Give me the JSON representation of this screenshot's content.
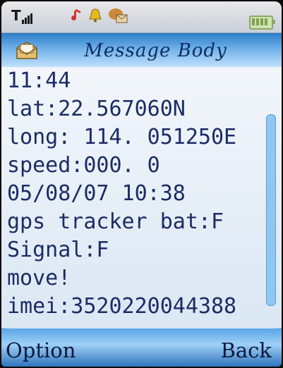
{
  "status_bar": {
    "signal_label": "T",
    "icons": [
      "signal-icon",
      "music-note-icon",
      "bell-icon",
      "message-icon",
      "battery-icon"
    ]
  },
  "header": {
    "title": "Message Body",
    "icon": "envelope-icon"
  },
  "message": {
    "lines": [
      "11:44",
      "lat:22.567060N",
      "long: 114. 051250E",
      "speed:000. 0",
      "05/08/07 10:38",
      "gps tracker bat:F",
      "Signal:F",
      "move!",
      "imei:3520220044388"
    ]
  },
  "softkeys": {
    "left": "Option",
    "right": "Back"
  },
  "colors": {
    "title_bar": "#4a95d8",
    "body_text": "#1c2c64",
    "screen_bg": "#dfe7f2"
  }
}
